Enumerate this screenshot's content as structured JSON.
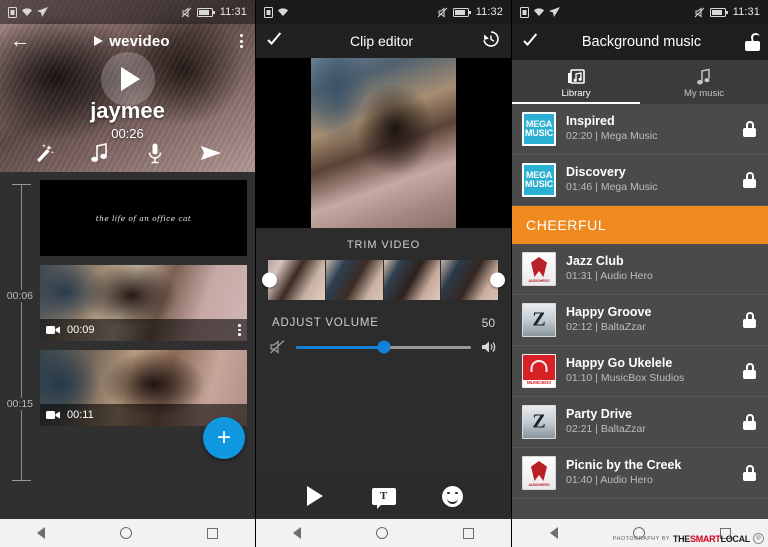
{
  "panels": {
    "editor": {
      "status": {
        "time": "11:31",
        "icons": [
          "sim-icon",
          "wifi-icon",
          "location-icon",
          "mute-icon",
          "battery-icon"
        ]
      },
      "appbar": {
        "back": "back-icon",
        "brand": "wevideo",
        "menu": "overflow-menu-icon"
      },
      "preview": {
        "play": "play-icon",
        "title": "jaymee",
        "duration": "00:26"
      },
      "tools": [
        {
          "name": "magic-wand-icon",
          "label": "Effects"
        },
        {
          "name": "music-note-icon",
          "label": "Music"
        },
        {
          "name": "microphone-icon",
          "label": "Voiceover"
        },
        {
          "name": "share-icon",
          "label": "Share"
        }
      ],
      "ruler": {
        "marks": [
          "00:06",
          "00:15"
        ]
      },
      "clips": [
        {
          "type": "text",
          "caption": "the life of an office cat",
          "duration": ""
        },
        {
          "type": "video",
          "caption": "",
          "duration": "00:09"
        },
        {
          "type": "video",
          "caption": "",
          "duration": "00:11"
        }
      ],
      "fab": "+"
    },
    "clip_editor": {
      "status": {
        "time": "11:32"
      },
      "appbar": {
        "confirm": "check-icon",
        "title": "Clip editor",
        "history": "history-icon"
      },
      "trim": {
        "label": "TRIM VIDEO"
      },
      "volume": {
        "label": "ADJUST VOLUME",
        "value": "50",
        "percent": 50,
        "mute_icon": "volume-mute-icon",
        "max_icon": "volume-up-icon"
      },
      "toolbar": [
        {
          "name": "play-icon",
          "label": "Play"
        },
        {
          "name": "text-icon",
          "label": "T"
        },
        {
          "name": "emoji-icon",
          "label": "Emoji"
        }
      ]
    },
    "music": {
      "status": {
        "time": "11:31"
      },
      "appbar": {
        "confirm": "check-icon",
        "title": "Background music",
        "lock": "unlock-icon"
      },
      "tabs": [
        {
          "label": "Library",
          "icon": "music-library-icon",
          "active": true
        },
        {
          "label": "My music",
          "icon": "music-note-icon",
          "active": false
        }
      ],
      "category": "CHEERFUL",
      "tracks_top": [
        {
          "title": "Inspired",
          "meta": "02:20 | Mega Music",
          "art": "mega",
          "art_text": "MEGA MUSIC",
          "locked": true
        },
        {
          "title": "Discovery",
          "meta": "01:46 | Mega Music",
          "art": "mega",
          "art_text": "MEGA MUSIC",
          "locked": true
        }
      ],
      "tracks_cheerful": [
        {
          "title": "Jazz Club",
          "meta": "01:31 | Audio Hero",
          "art": "hero",
          "art_text": "AUDIOHERO",
          "locked": false
        },
        {
          "title": "Happy Groove",
          "meta": "02:12 | BaltaZzar",
          "art": "z",
          "art_text": "Z",
          "locked": true
        },
        {
          "title": "Happy Go Ukelele",
          "meta": "01:10 | MusicBox Studios",
          "art": "box",
          "art_text": "MUSICBOX",
          "locked": true
        },
        {
          "title": "Party Drive",
          "meta": "02:21 | BaltaZzar",
          "art": "z",
          "art_text": "Z",
          "locked": true
        },
        {
          "title": "Picnic by the Creek",
          "meta": "01:40 | Audio Hero",
          "art": "hero",
          "art_text": "AUDIOHERO",
          "locked": true
        }
      ]
    }
  },
  "navbar": {
    "back": "nav-back-icon",
    "home": "nav-home-icon",
    "recents": "nav-recents-icon"
  },
  "watermark": {
    "prefix": "PHOTOGRAPHY BY",
    "brand_the": "THE",
    "brand_smart": "SMART",
    "brand_local": "LOCAL",
    "mark": "®"
  },
  "colors": {
    "accent_blue": "#1581d6",
    "fab_blue": "#0f97e0",
    "category_orange": "#f08a1e",
    "mega_cyan": "#2ab0d2"
  }
}
